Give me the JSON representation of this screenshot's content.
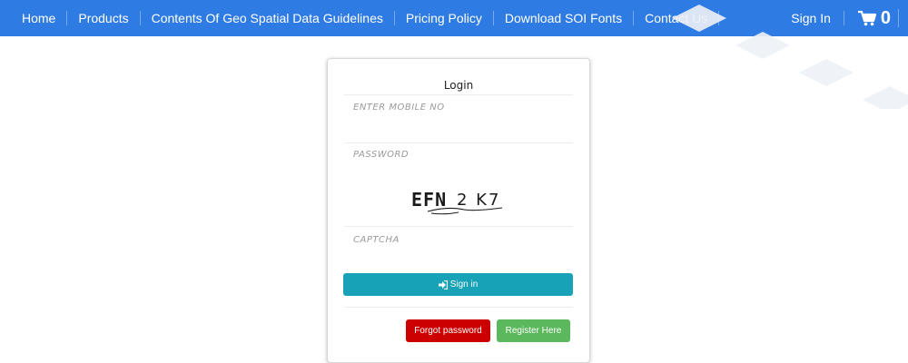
{
  "nav": {
    "items": [
      {
        "label": "Home"
      },
      {
        "label": "Products"
      },
      {
        "label": "Contents Of Geo Spatial Data Guidelines"
      },
      {
        "label": "Pricing Policy"
      },
      {
        "label": "Download SOI Fonts"
      },
      {
        "label": "Contact Us"
      }
    ],
    "signin_label": "Sign In",
    "cart_count": "0",
    "cart_icon": "shopping-cart-icon"
  },
  "colors": {
    "navbar_bg": "#2f7be4",
    "signin_button": "#17a2b8",
    "forgot_button": "#cc0000",
    "register_button": "#5cb85c"
  },
  "login": {
    "title": "Login",
    "mobile_placeholder": "ENTER MOBILE NO",
    "mobile_value": "",
    "password_placeholder": "PASSWORD",
    "password_value": "",
    "captcha_text": "EFN2K7",
    "captcha_placeholder": "CAPTCHA",
    "captcha_value": "",
    "signin_icon": "sign-in-icon",
    "signin_label": "Sign in",
    "forgot_label": "Forgot password",
    "register_label": "Register Here"
  }
}
